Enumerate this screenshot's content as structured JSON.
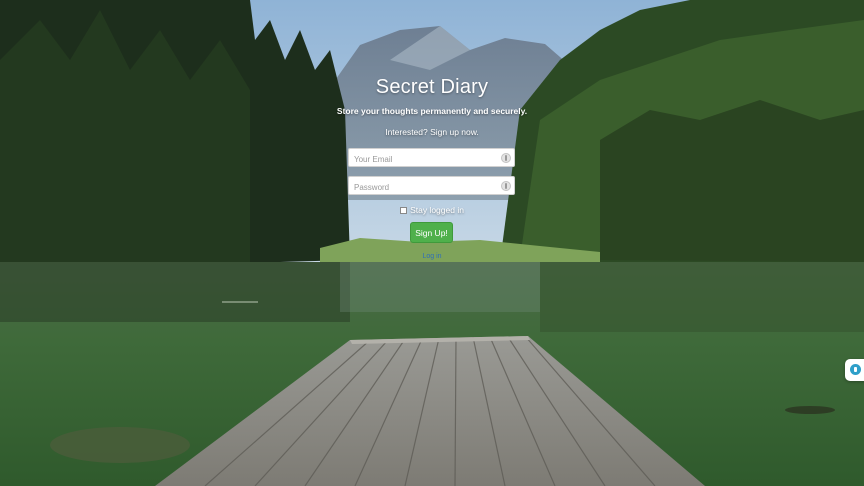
{
  "app": {
    "title": "Secret Diary",
    "tagline": "Store your thoughts permanently and securely.",
    "signup_prompt": "Interested? Sign up now."
  },
  "form": {
    "email_placeholder": "Your Email",
    "password_placeholder": "Password",
    "stay_logged_in_label": "Stay logged in",
    "stay_logged_in_checked": false,
    "submit_label": "Sign Up!",
    "login_link_label": "Log in"
  },
  "colors": {
    "submit_button": "#4fb04b",
    "login_link": "#2f6fb8",
    "widget_accent": "#2e9fc9"
  },
  "icons": {
    "field_key_icon": "password-manager-key-icon",
    "side_widget_icon": "assistant-widget-icon"
  }
}
